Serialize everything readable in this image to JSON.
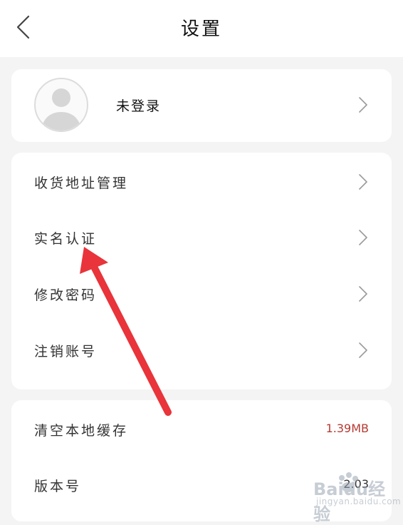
{
  "header": {
    "title": "设置",
    "back_icon": "chevron-left-icon"
  },
  "profile": {
    "name": "未登录",
    "avatar_icon": "default-avatar-icon"
  },
  "menu": {
    "items": [
      {
        "label": "收货地址管理"
      },
      {
        "label": "实名认证"
      },
      {
        "label": "修改密码"
      },
      {
        "label": "注销账号"
      }
    ]
  },
  "info": {
    "items": [
      {
        "label": "清空本地缓存",
        "value": "1.39MB"
      },
      {
        "label": "版本号",
        "value": "2.03"
      }
    ]
  },
  "colors": {
    "accent_value": "#b73a33",
    "annotation_arrow": "#e8343a"
  },
  "watermark": {
    "text": "Baidu经验",
    "sub": "jingyan.baidu.com"
  }
}
